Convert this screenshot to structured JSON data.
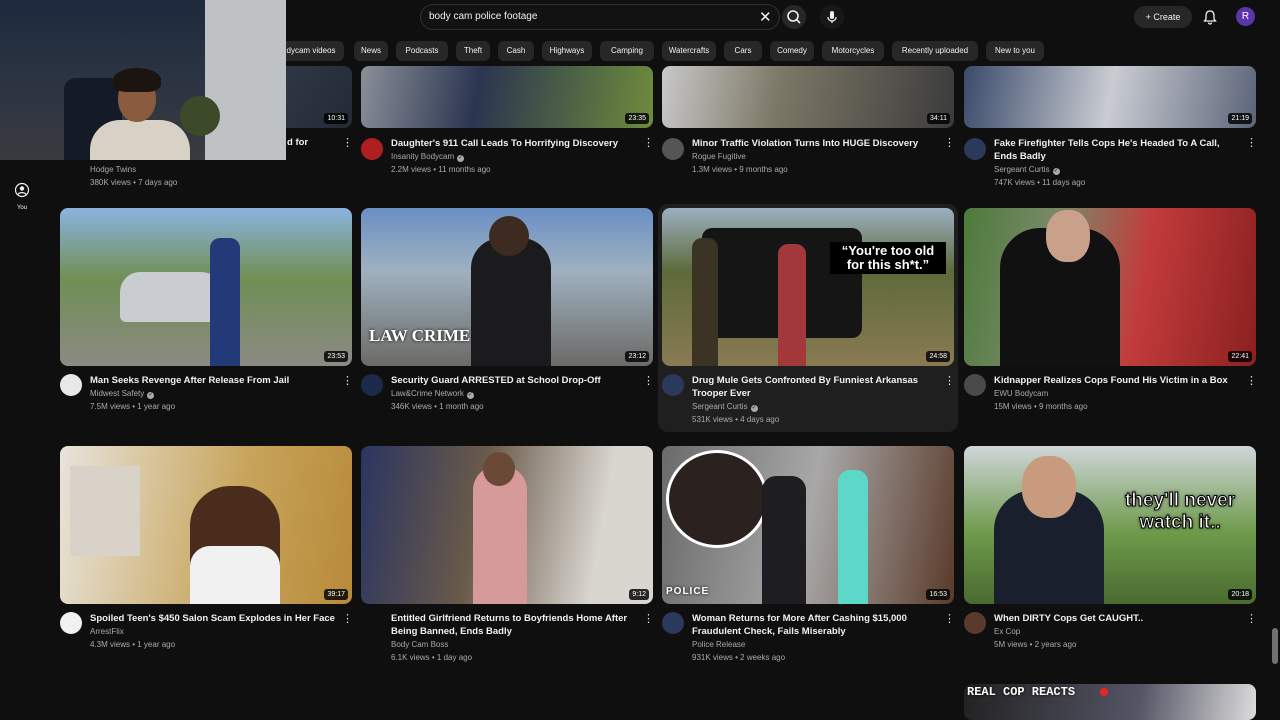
{
  "header": {
    "search_value": "body cam police footage",
    "create_label": "Create",
    "avatar_letter": "R",
    "accent_color": "#5c35a8"
  },
  "chips": [
    "dycam videos",
    "News",
    "Podcasts",
    "Theft",
    "Cash",
    "Highways",
    "Camping",
    "Watercrafts",
    "Cars",
    "Comedy",
    "Motorcycles",
    "Recently uploaded",
    "New to you"
  ],
  "sidebar": {
    "you_label": "You"
  },
  "webcam": {
    "title_fragment": "d for"
  },
  "videos": [
    {
      "title": "",
      "channel": "Hodge Twins",
      "verified": false,
      "meta": "380K views • 7 days ago",
      "duration": "10:31"
    },
    {
      "title": "Daughter's 911 Call Leads To Horrifying Discovery",
      "channel": "Insanity Bodycam",
      "verified": true,
      "meta": "2.2M views • 11 months ago",
      "duration": "23:35"
    },
    {
      "title": "Minor Traffic Violation Turns Into HUGE Discovery",
      "channel": "Rogue Fugitive",
      "verified": false,
      "meta": "1.3M views • 9 months ago",
      "duration": "34:11"
    },
    {
      "title": "Fake Firefighter Tells Cops He's Headed To A Call, Ends Badly",
      "channel": "Sergeant Curtis",
      "verified": true,
      "meta": "747K views • 11 days ago",
      "duration": "21:19"
    },
    {
      "title": "Man Seeks Revenge After Release From Jail",
      "channel": "Midwest Safety",
      "verified": true,
      "meta": "7.5M views • 1 year ago",
      "duration": "23:53"
    },
    {
      "title": "Security Guard ARRESTED at School Drop-Off",
      "channel": "Law&Crime Network",
      "verified": true,
      "meta": "346K views • 1 month ago",
      "duration": "23:12",
      "overlay": "LAW CRIME"
    },
    {
      "title": "Drug Mule Gets Confronted By Funniest Arkansas Trooper Ever",
      "channel": "Sergeant Curtis",
      "verified": true,
      "meta": "531K views • 4 days ago",
      "duration": "24:58",
      "overlay": "“You're too old for this sh*t.”"
    },
    {
      "title": "Kidnapper Realizes Cops Found His Victim in a Box",
      "channel": "EWU Bodycam",
      "verified": false,
      "meta": "15M views • 9 months ago",
      "duration": "22:41"
    },
    {
      "title": "Spoiled Teen's $450 Salon Scam Explodes in Her Face",
      "channel": "ArrestFlix",
      "verified": false,
      "meta": "4.3M views • 1 year ago",
      "duration": "39:17"
    },
    {
      "title": "Entitled Girlfriend Returns to Boyfriends Home After Being Banned, Ends Badly",
      "channel": "Body Cam Boss",
      "verified": false,
      "meta": "6.1K views • 1 day ago",
      "duration": "9:12"
    },
    {
      "title": "Woman Returns for More After Cashing $15,000 Fraudulent Check, Fails Miserably",
      "channel": "Police Release",
      "verified": false,
      "meta": "931K views • 2 weeks ago",
      "duration": "16:53",
      "overlay": "POLICE"
    },
    {
      "title": "When DIRTY Cops Get CAUGHT..",
      "channel": "Ex Cop",
      "verified": false,
      "meta": "5M views • 2 years ago",
      "duration": "20:18",
      "overlay": "they'll never watch it.."
    }
  ],
  "partial_thumb": {
    "overlay": "REAL COP REACTS"
  }
}
